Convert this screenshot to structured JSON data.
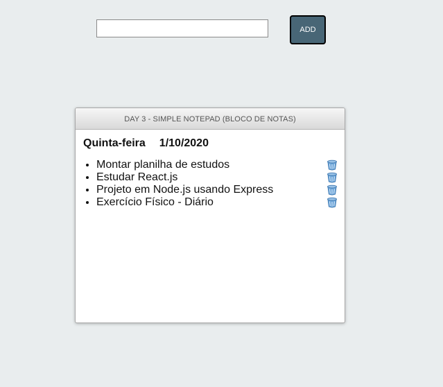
{
  "form": {
    "input_value": "",
    "add_label": "ADD"
  },
  "notepad": {
    "title": "DAY 3 - SIMPLE NOTEPAD (BLOCO DE NOTAS)",
    "weekday": "Quinta-feira",
    "date": "1/10/2020",
    "tasks": [
      {
        "text": "Montar planilha de estudos",
        "icon": "trash-icon"
      },
      {
        "text": "Estudar React.js",
        "icon": "trash-icon"
      },
      {
        "text": "Projeto em Node.js usando Express",
        "icon": "trash-icon"
      },
      {
        "text": "Exercício Físico - Diário",
        "icon": "trash-icon"
      }
    ]
  },
  "colors": {
    "background": "#e9edee",
    "add_button": "#486676",
    "trash": "#5b93c8"
  }
}
